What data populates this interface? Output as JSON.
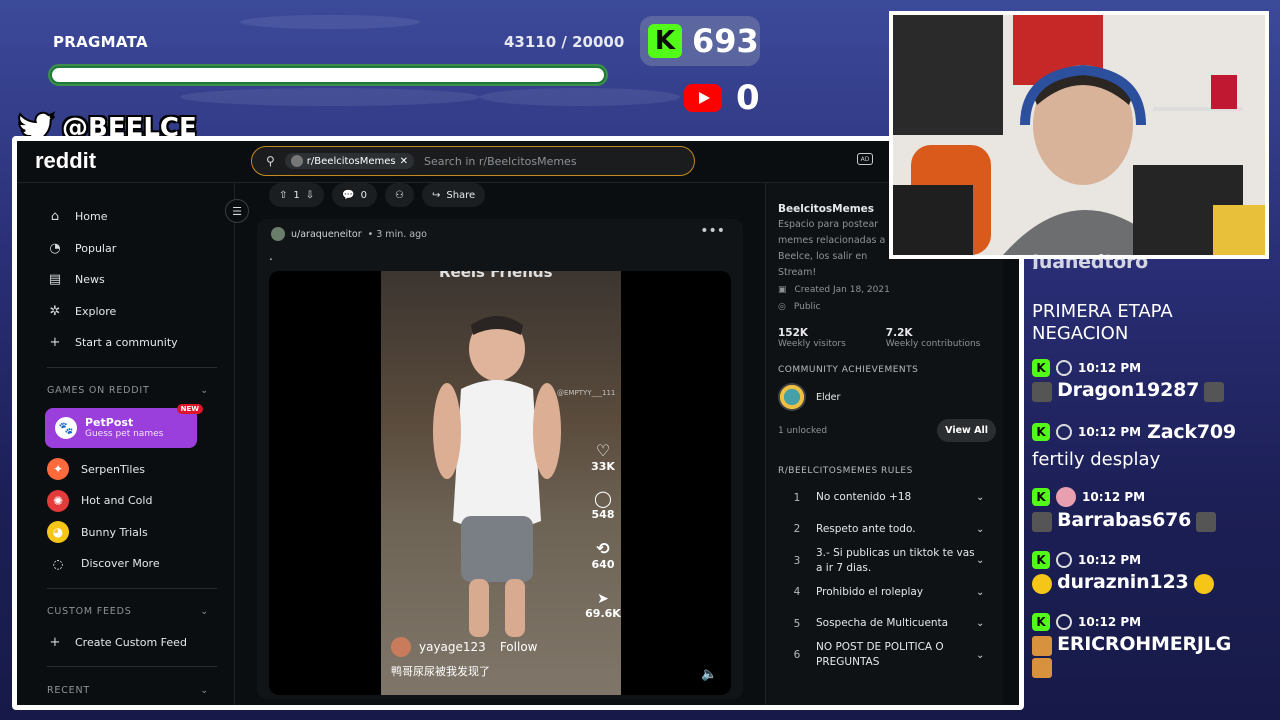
{
  "stream_overlay": {
    "goal": {
      "title": "PRAGMATA",
      "count_text": "43110 / 20000",
      "progress_fraction": 1.0
    },
    "kick_count": "693",
    "youtube_count": "0",
    "twitter_handle": "@BEELCE_"
  },
  "reddit": {
    "logo": "reddit",
    "search": {
      "community_chip": "r/BeelcitosMemes",
      "placeholder": "Search in r/BeelcitosMemes"
    },
    "nav": {
      "items": [
        {
          "label": "Home",
          "icon": "home-icon"
        },
        {
          "label": "Popular",
          "icon": "popular-icon"
        },
        {
          "label": "News",
          "icon": "news-icon"
        },
        {
          "label": "Explore",
          "icon": "explore-icon"
        },
        {
          "label": "Start a community",
          "icon": "plus-icon"
        }
      ],
      "games_header": "GAMES ON REDDIT",
      "petpost": {
        "title": "PetPost",
        "subtitle": "Guess pet names",
        "badge": "NEW"
      },
      "games": [
        {
          "label": "SerpenTiles",
          "color": "#ff6a3d"
        },
        {
          "label": "Hot and Cold",
          "color": "#e43a3a"
        },
        {
          "label": "Bunny Trials",
          "color": "#f5c518"
        },
        {
          "label": "Discover More",
          "color": "#0b0e10"
        }
      ],
      "custom_feeds_header": "CUSTOM FEEDS",
      "create_feed": "Create Custom Feed",
      "recent_header": "RECENT"
    },
    "post": {
      "actions": {
        "votes": "1",
        "comments": "0",
        "share": "Share"
      },
      "author": "u/araqueneitor",
      "time": "• 3 min. ago",
      "body": ".",
      "video": {
        "top_text": "Reels  Friends",
        "likes": "33K",
        "comments": "548",
        "reposts": "640",
        "shares": "69.6K",
        "watermark": "@EMPTYY___111",
        "username": "yayage123",
        "follow": "Follow",
        "caption": "鸭哥尿尿被我发现了"
      }
    },
    "sidebar": {
      "name": "BeelcitosMemes",
      "description": "Espacio para postear memes relacionadas a Beelce, los salir en Stream!",
      "created": "Created Jan 18, 2021",
      "visibility": "Public",
      "weekly_visitors": "152K",
      "weekly_visitors_label": "Weekly visitors",
      "weekly_contrib": "7.2K",
      "weekly_contrib_label": "Weekly contributions",
      "achievements_header": "COMMUNITY ACHIEVEMENTS",
      "achievement": "Elder",
      "unlocked": "1 unlocked",
      "view_all": "View All",
      "rules_header": "R/BEELCITOSMEMES RULES",
      "rules": [
        {
          "n": "1",
          "t": "No contenido +18"
        },
        {
          "n": "2",
          "t": "Respeto ante todo."
        },
        {
          "n": "3",
          "t": "3.- Si publicas un tiktok te vas a ir 7 dias."
        },
        {
          "n": "4",
          "t": "Prohibido el roleplay"
        },
        {
          "n": "5",
          "t": "Sospecha de Multicuenta"
        },
        {
          "n": "6",
          "t": "NO POST DE POLITICA O PREGUNTAS"
        }
      ]
    }
  },
  "chat": {
    "partial_top": "Juanedtoro",
    "messages": [
      {
        "text": "PRIMERA ETAPA NEGACION"
      },
      {
        "time": "10:12 PM",
        "name": "Dragon19287"
      },
      {
        "time": "10:12 PM",
        "name": "Zack709",
        "text": "fertily desplay"
      },
      {
        "time": "10:12 PM",
        "name": "Barrabas676"
      },
      {
        "time": "10:12 PM",
        "name": "duraznin123"
      },
      {
        "time": "10:12 PM",
        "name": "ERICROHMERJLG"
      }
    ]
  }
}
